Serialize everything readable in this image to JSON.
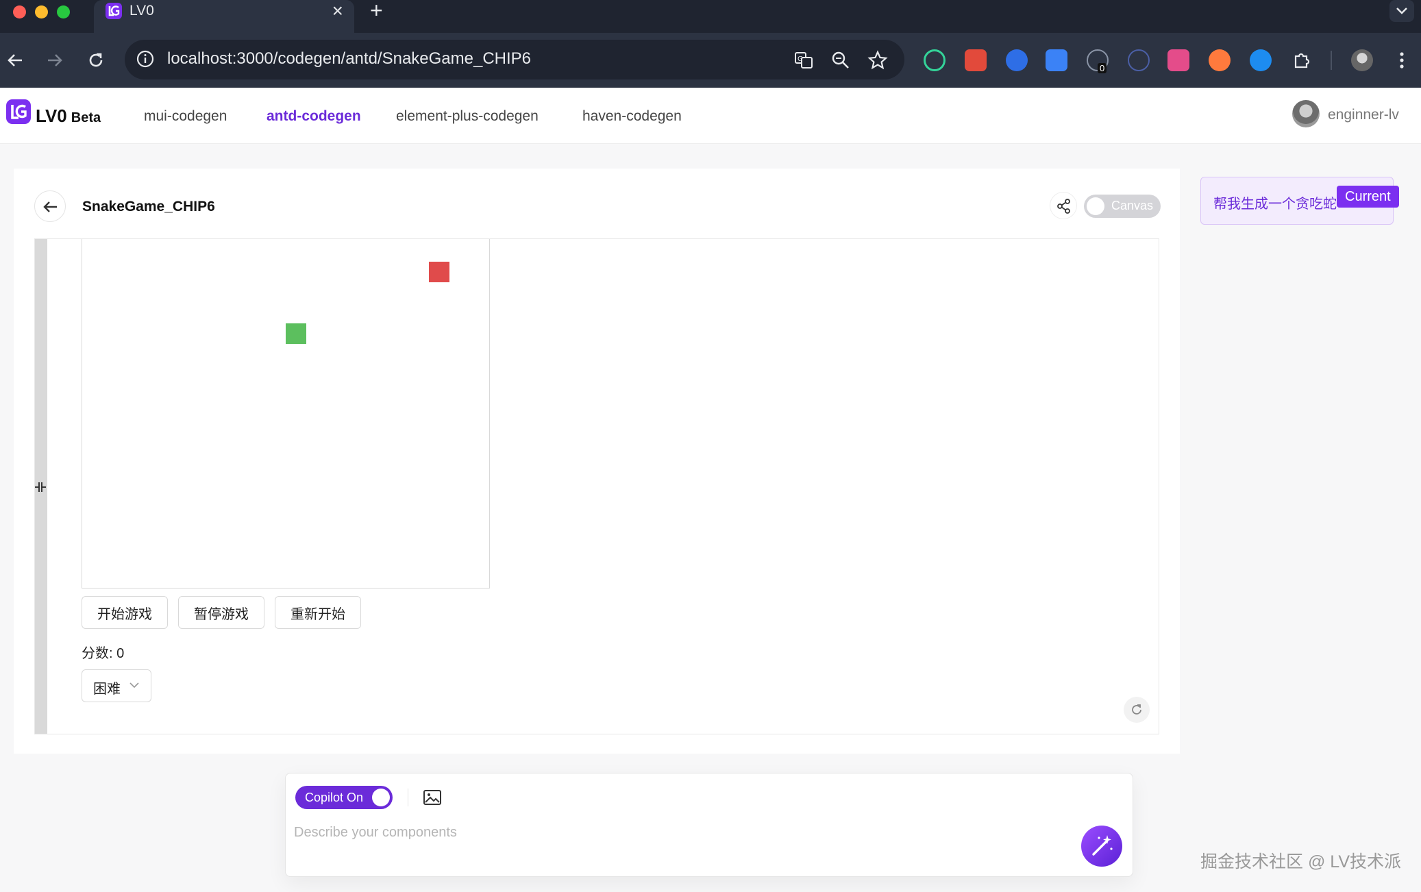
{
  "browser": {
    "tab_title": "LV0",
    "tab_close": "×",
    "new_tab": "+",
    "url": "localhost:3000/codegen/antd/SnakeGame_CHIP6",
    "extension_badge": "0"
  },
  "header": {
    "brand": "LV0",
    "beta": "Beta",
    "nav": [
      {
        "label": "mui-codegen",
        "active": false
      },
      {
        "label": "antd-codegen",
        "active": true
      },
      {
        "label": "element-plus-codegen",
        "active": false
      },
      {
        "label": "haven-codegen",
        "active": false
      }
    ],
    "username": "enginner-lv"
  },
  "page": {
    "title": "SnakeGame_CHIP6",
    "canvas_toggle_label": "Canvas",
    "canvas_on": false
  },
  "game": {
    "buttons": [
      "开始游戏",
      "暂停游戏",
      "重新开始"
    ],
    "score_label": "分数: 0",
    "difficulty": "困难",
    "colors": {
      "food": "#e04b4b",
      "snake": "#5cbf5e"
    }
  },
  "history": {
    "item_text": "帮我生成一个贪吃蛇",
    "badge": "Current"
  },
  "prompt": {
    "copilot_label": "Copilot On",
    "copilot_on": true,
    "placeholder": "Describe your components",
    "value": ""
  },
  "watermark": "掘金技术社区 @ LV技术派",
  "colors": {
    "accent": "#6b2bd9",
    "chrome": "#2c3342"
  }
}
